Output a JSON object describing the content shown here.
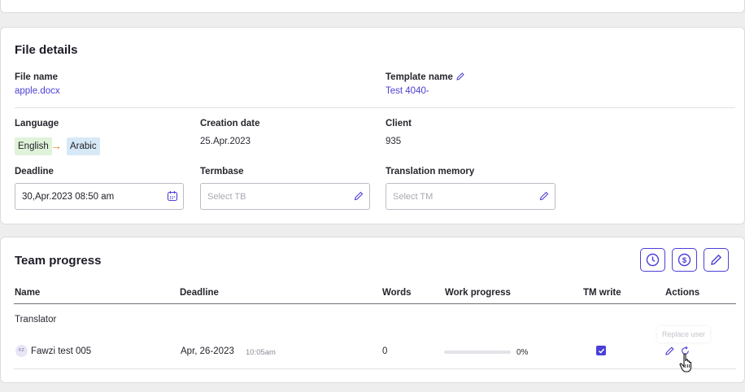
{
  "file_details": {
    "title": "File details",
    "file_name_label": "File name",
    "file_name_value": "apple.docx",
    "template_label": "Template name",
    "template_value": "Test 4040-",
    "language_label": "Language",
    "source_language": "English",
    "target_language": "Arabic",
    "creation_label": "Creation date",
    "creation_value": "25.Apr.2023",
    "client_label": "Client",
    "client_value": "935",
    "deadline_label": "Deadline",
    "deadline_value": "30,Apr.2023 08:50 am",
    "termbase_label": "Termbase",
    "termbase_placeholder": "Select TB",
    "tm_label": "Translation memory",
    "tm_placeholder": "Select TM"
  },
  "team_progress": {
    "title": "Team progress",
    "columns": [
      "Name",
      "Deadline",
      "Words",
      "Work progress",
      "TM write",
      "Actions"
    ],
    "group_label": "Translator",
    "rows": [
      {
        "avatar_initials": "FZ",
        "name": "Fawzi test 005",
        "deadline_date": "Apr, 26-2023",
        "deadline_time": "10:05am",
        "words": "0",
        "progress_percent": 0,
        "progress_label": "0%",
        "tm_write": true
      }
    ],
    "tooltip": "Replace user"
  },
  "colors": {
    "accent": "#4b3fd6",
    "source_chip": "#dff3d9",
    "target_chip": "#d7e9f7",
    "arrow": "#e0891f"
  }
}
